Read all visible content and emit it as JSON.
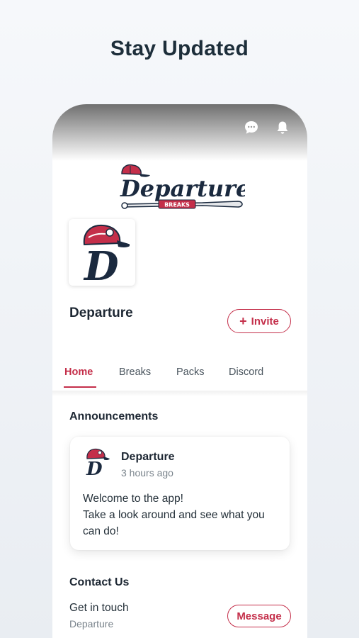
{
  "headline": "Stay Updated",
  "header_icons": [
    "chat-icon",
    "bell-icon"
  ],
  "brand": {
    "logo_text": "Departure",
    "logo_subtext": "BREAKS",
    "avatar_letter": "D"
  },
  "profile": {
    "name": "Departure",
    "invite_label": "Invite"
  },
  "tabs": [
    {
      "label": "Home",
      "active": true
    },
    {
      "label": "Breaks",
      "active": false
    },
    {
      "label": "Packs",
      "active": false
    },
    {
      "label": "Discord",
      "active": false
    }
  ],
  "announcements": {
    "title": "Announcements",
    "post": {
      "author": "Departure",
      "time": "3 hours ago",
      "line1": "Welcome to the app!",
      "line2": "Take a look around and see what you can do!"
    }
  },
  "contact": {
    "title": "Contact Us",
    "label": "Get in touch",
    "sub": "Departure",
    "button_label": "Message"
  },
  "colors": {
    "accent": "#c42f4a",
    "navy": "#1b2a3f",
    "text": "#1d2733"
  }
}
